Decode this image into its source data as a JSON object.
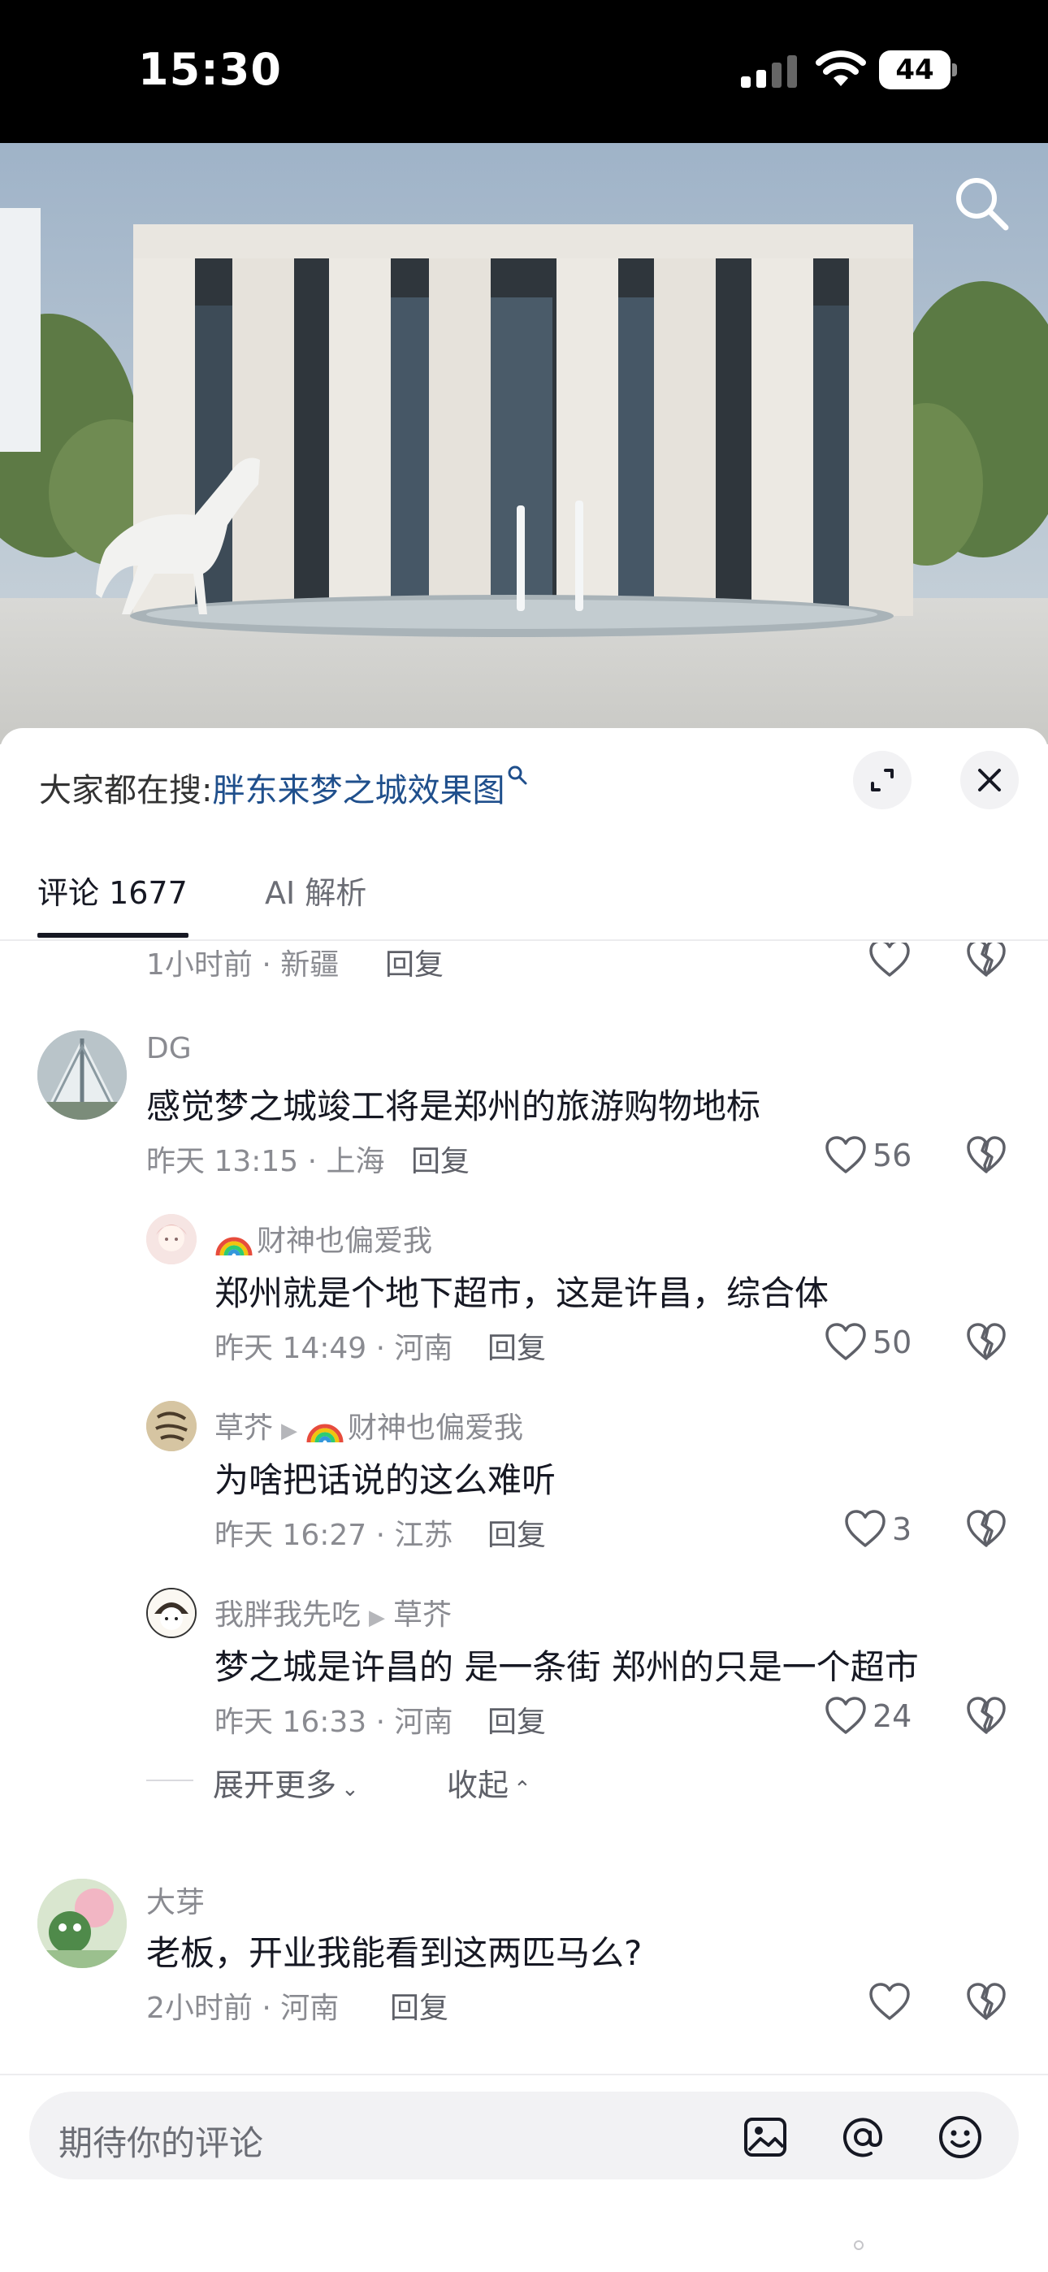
{
  "status_bar": {
    "time": "15:30",
    "battery": "44"
  },
  "hero": {
    "search_icon": "search-icon"
  },
  "sheet": {
    "search_label": "大家都在搜:",
    "search_query": "胖东来梦之城效果图",
    "tabs": {
      "comments": "评论 1677",
      "ai": "AI 解析"
    }
  },
  "comments": {
    "prev": {
      "meta": "1小时前 · 新疆",
      "reply": "回复"
    },
    "c1": {
      "name": "DG",
      "text": "感觉梦之城竣工将是郑州的旅游购物地标",
      "meta": "昨天 13:15 · 上海",
      "reply": "回复",
      "likes": "56"
    },
    "r1": {
      "name": "财神也偏爱我",
      "text": "郑州就是个地下超市，这是许昌，综合体",
      "meta": "昨天 14:49 · 河南",
      "reply": "回复",
      "likes": "50"
    },
    "r2": {
      "name": "草芥",
      "to": "财神也偏爱我",
      "text": "为啥把话说的这么难听",
      "meta": "昨天 16:27 · 江苏",
      "reply": "回复",
      "likes": "3"
    },
    "r3": {
      "name": "我胖我先吃",
      "to": "草芥",
      "text": "梦之城是许昌的  是一条街 郑州的只是一个超市",
      "meta": "昨天 16:33 · 河南",
      "reply": "回复",
      "likes": "24"
    },
    "expand_more": "展开更多",
    "collapse": "收起",
    "c2": {
      "name": "大芽",
      "text": "老板，开业我能看到这两匹马么?",
      "meta": "2小时前 · 河南",
      "reply": "回复"
    }
  },
  "input": {
    "placeholder": "期待你的评论"
  }
}
